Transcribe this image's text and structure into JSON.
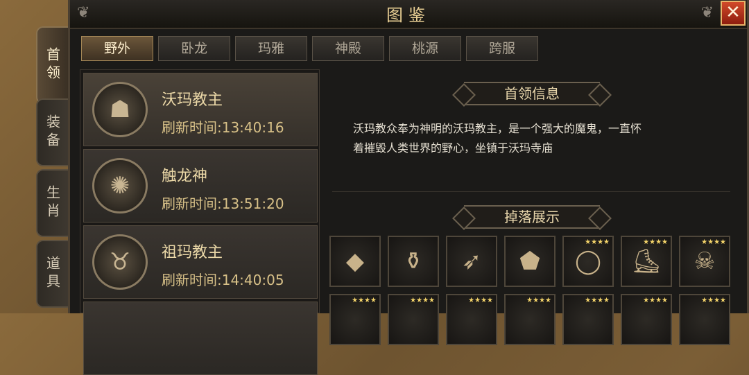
{
  "window": {
    "title": "图鉴",
    "close_label": "✕"
  },
  "side_tabs": [
    {
      "label": "首领",
      "active": true
    },
    {
      "label": "装备",
      "active": false
    },
    {
      "label": "生肖",
      "active": false
    },
    {
      "label": "道具",
      "active": false
    }
  ],
  "tabs": [
    {
      "label": "野外",
      "active": true
    },
    {
      "label": "卧龙",
      "active": false
    },
    {
      "label": "玛雅",
      "active": false
    },
    {
      "label": "神殿",
      "active": false
    },
    {
      "label": "桃源",
      "active": false
    },
    {
      "label": "跨服",
      "active": false
    }
  ],
  "bosses": [
    {
      "name": "沃玛教主",
      "time": "刷新时间:13:40:16",
      "icon": "armored-demon-icon"
    },
    {
      "name": "触龙神",
      "time": "刷新时间:13:51:20",
      "icon": "insect-dragon-icon"
    },
    {
      "name": "祖玛教主",
      "time": "刷新时间:14:40:05",
      "icon": "horned-demon-icon"
    }
  ],
  "info": {
    "header": "首领信息",
    "description_line1": "沃玛教众奉为神明的沃玛教主，是一个强大的魔鬼，一直怀",
    "description_line2": "着摧毁人类世界的野心，坐镇于沃玛寺庙"
  },
  "drops": {
    "header": "掉落展示",
    "row1": [
      {
        "icon": "fire-crystal-icon",
        "stars": ""
      },
      {
        "icon": "potion-icon",
        "stars": ""
      },
      {
        "icon": "horn-icon",
        "stars": ""
      },
      {
        "icon": "rune-stone-icon",
        "stars": ""
      },
      {
        "icon": "bracelet-icon",
        "stars": "★★★★"
      },
      {
        "icon": "boots-icon",
        "stars": "★★★★"
      },
      {
        "icon": "skull-helmet-icon",
        "stars": "★★★★"
      }
    ],
    "row2_stars": [
      "★★★★",
      "★★★★",
      "★★★★",
      "★★★★",
      "★★★★",
      "★★★★",
      "★★★★"
    ]
  }
}
